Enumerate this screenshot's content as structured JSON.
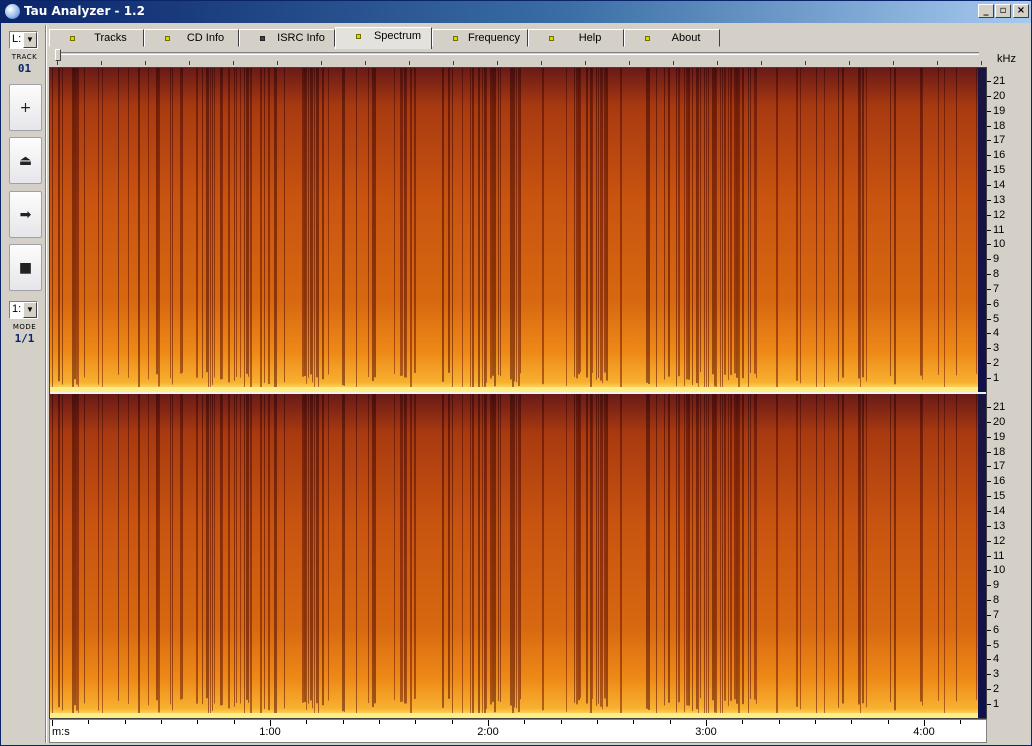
{
  "window": {
    "title": "Tau Analyzer - 1.2",
    "controls": {
      "minimize": "_",
      "maximize": "▫",
      "close": "×"
    }
  },
  "sidebar": {
    "track_select": "L:",
    "track_caption": "TRACK",
    "track_number": "01",
    "mode_select": "1:",
    "mode_caption": "MODE",
    "mode_value": "1/1",
    "buttons": [
      {
        "name": "add",
        "icon": "plus-icon",
        "glyph": "+"
      },
      {
        "name": "eject",
        "icon": "eject-icon",
        "glyph": "⏏"
      },
      {
        "name": "next",
        "icon": "arrow-right-icon",
        "glyph": "➡"
      },
      {
        "name": "stop",
        "icon": "stop-icon",
        "glyph": "■"
      }
    ]
  },
  "tabs": [
    {
      "label": "Tracks",
      "active": false,
      "led": "on"
    },
    {
      "label": "CD Info",
      "active": false,
      "led": "on"
    },
    {
      "label": "ISRC Info",
      "active": false,
      "led": "off"
    },
    {
      "label": "Spectrum",
      "active": true,
      "led": "on"
    },
    {
      "label": "Frequency",
      "active": false,
      "led": "on"
    },
    {
      "label": "Help",
      "active": false,
      "led": "on"
    },
    {
      "label": "About",
      "active": false,
      "led": "on"
    }
  ],
  "spectrum": {
    "freq_unit": "kHz",
    "freq_ticks": [
      "21",
      "20",
      "19",
      "18",
      "17",
      "16",
      "15",
      "14",
      "13",
      "12",
      "11",
      "10",
      "9",
      "8",
      "7",
      "6",
      "5",
      "4",
      "3",
      "2",
      "1"
    ],
    "time_unit": "m:s",
    "time_ticks": [
      "1:00",
      "2:00",
      "3:00",
      "4:00"
    ],
    "channels": [
      "left",
      "right"
    ],
    "colors": {
      "low": "#1a1440",
      "mid": "#c85410",
      "high": "#fff080"
    }
  }
}
